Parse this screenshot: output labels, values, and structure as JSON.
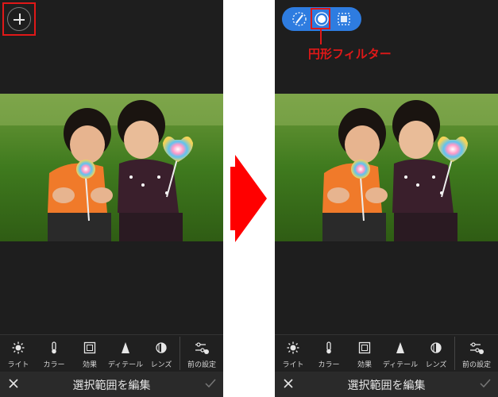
{
  "left_panel": {
    "plus_button_label": "+",
    "toolbar": [
      {
        "label": "ライト",
        "icon": "sun-icon"
      },
      {
        "label": "カラー",
        "icon": "thermometer-icon"
      },
      {
        "label": "効果",
        "icon": "frame-icon"
      },
      {
        "label": "ディテール",
        "icon": "triangle-icon"
      },
      {
        "label": "レンズ",
        "icon": "lens-icon"
      }
    ],
    "prev_settings_label": "前の設定",
    "bottom_title": "選択範囲を編集"
  },
  "right_panel": {
    "callout_label": "円形フィルター",
    "toolbar": [
      {
        "label": "ライト",
        "icon": "sun-icon"
      },
      {
        "label": "カラー",
        "icon": "thermometer-icon"
      },
      {
        "label": "効果",
        "icon": "frame-icon"
      },
      {
        "label": "ディテール",
        "icon": "triangle-icon"
      },
      {
        "label": "レンズ",
        "icon": "lens-icon"
      }
    ],
    "prev_settings_label": "前の設定",
    "bottom_title": "選択範囲を編集"
  },
  "colors": {
    "background": "#1e1e1e",
    "accent_blue": "#2e7ce0",
    "highlight_red": "#e01818",
    "arrow_red": "#ff0000"
  }
}
